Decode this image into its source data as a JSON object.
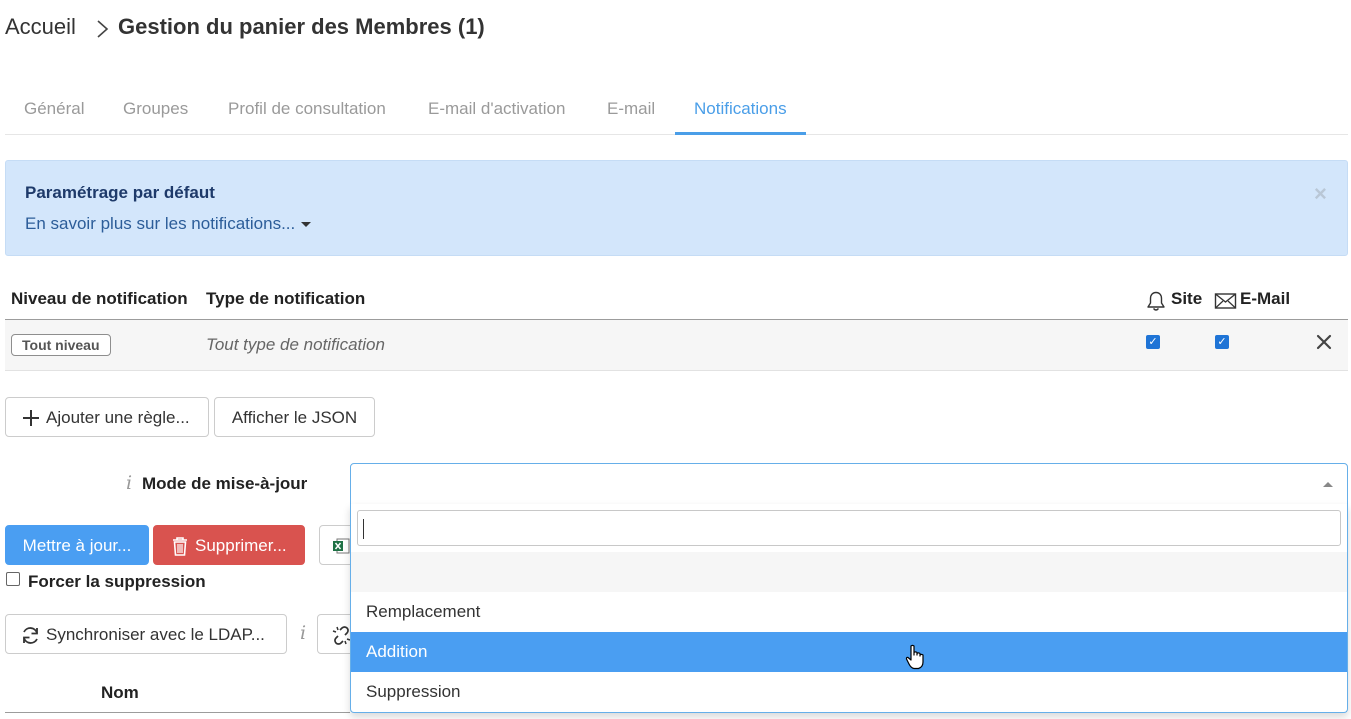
{
  "breadcrumb": {
    "home": "Accueil",
    "title": "Gestion du panier des Membres (1)"
  },
  "tabs": [
    {
      "label": "Général",
      "active": false
    },
    {
      "label": "Groupes",
      "active": false
    },
    {
      "label": "Profil de consultation",
      "active": false
    },
    {
      "label": "E-mail d'activation",
      "active": false
    },
    {
      "label": "E-mail",
      "active": false
    },
    {
      "label": "Notifications",
      "active": true
    }
  ],
  "alert": {
    "title": "Paramétrage par défaut",
    "link": "En savoir plus sur les notifications...",
    "close": "×"
  },
  "rules_table": {
    "headers": {
      "level": "Niveau de notification",
      "type": "Type de notification",
      "site": "Site",
      "email": "E-Mail"
    },
    "rows": [
      {
        "level": "Tout niveau",
        "type": "Tout type de notification",
        "site": true,
        "email": true
      }
    ]
  },
  "actions": {
    "add_rule": "Ajouter une règle...",
    "show_json": "Afficher le JSON"
  },
  "mode": {
    "label": "Mode de mise-à-jour",
    "search_value": "",
    "options": [
      "",
      "Remplacement",
      "Addition",
      "Suppression"
    ],
    "highlighted": "Addition"
  },
  "buttons": {
    "update": "Mettre à jour...",
    "delete": "Supprimer...",
    "force_delete": "Forcer la suppression",
    "sync_ldap": "Synchroniser avec le LDAP..."
  },
  "members_table": {
    "col_name": "Nom"
  },
  "colors": {
    "accent": "#4a9ee8",
    "danger": "#d9534f",
    "alert_bg": "#d3e6fb"
  }
}
